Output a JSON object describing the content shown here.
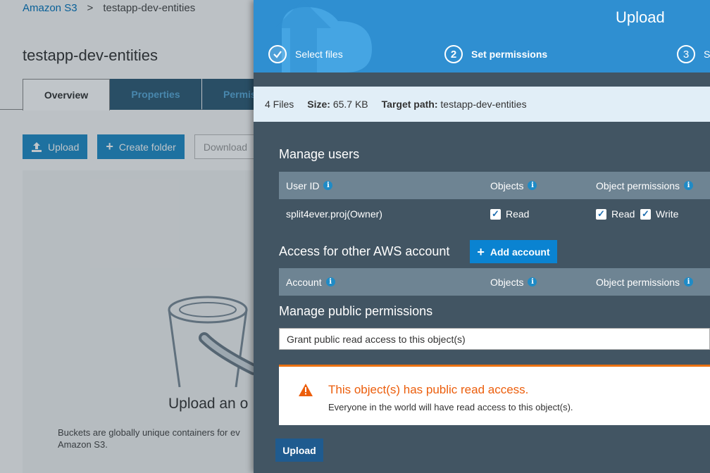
{
  "background": {
    "breadcrumb": {
      "root": "Amazon S3",
      "separator": ">",
      "current": "testapp-dev-entities"
    },
    "page_title": "testapp-dev-entities",
    "tabs": {
      "overview": "Overview",
      "properties": "Properties",
      "permissions": "Permis"
    },
    "buttons": {
      "upload": "Upload",
      "create_folder": "Create folder",
      "download": "Download"
    },
    "empty_state": {
      "title": "Upload an o",
      "description": "Buckets are globally unique containers for ev Amazon S3."
    }
  },
  "panel": {
    "title": "Upload",
    "steps": [
      {
        "number": "1",
        "label": "Select files",
        "state": "completed"
      },
      {
        "number": "2",
        "label": "Set permissions",
        "state": "active"
      },
      {
        "number": "3",
        "label": "S",
        "state": "pending"
      }
    ],
    "summary": {
      "files": "4 Files",
      "size_label": "Size:",
      "size_value": "65.7 KB",
      "target_label": "Target path:",
      "target_value": "testapp-dev-entities"
    },
    "manage_users": {
      "heading": "Manage users",
      "columns": {
        "user_id": "User ID",
        "objects": "Objects",
        "object_permissions": "Object permissions"
      },
      "rows": [
        {
          "user": "split4ever.proj(Owner)",
          "objects_read": "Read",
          "perm_read": "Read",
          "perm_write": "Write"
        }
      ]
    },
    "other_accounts": {
      "heading": "Access for other AWS account",
      "add_button": "Add account",
      "columns": {
        "account": "Account",
        "objects": "Objects",
        "object_permissions": "Object permissions"
      }
    },
    "public_permissions": {
      "heading": "Manage public permissions",
      "selected": "Grant public read access to this object(s)"
    },
    "warning": {
      "title": "This object(s) has public read access.",
      "text": "Everyone in the world will have read access to this object(s)."
    },
    "upload_button": "Upload"
  },
  "colors": {
    "panel_bg": "#425563",
    "header_bg": "#2f8fd1",
    "accent": "#0a83d1",
    "warning": "#ec5e0c"
  }
}
